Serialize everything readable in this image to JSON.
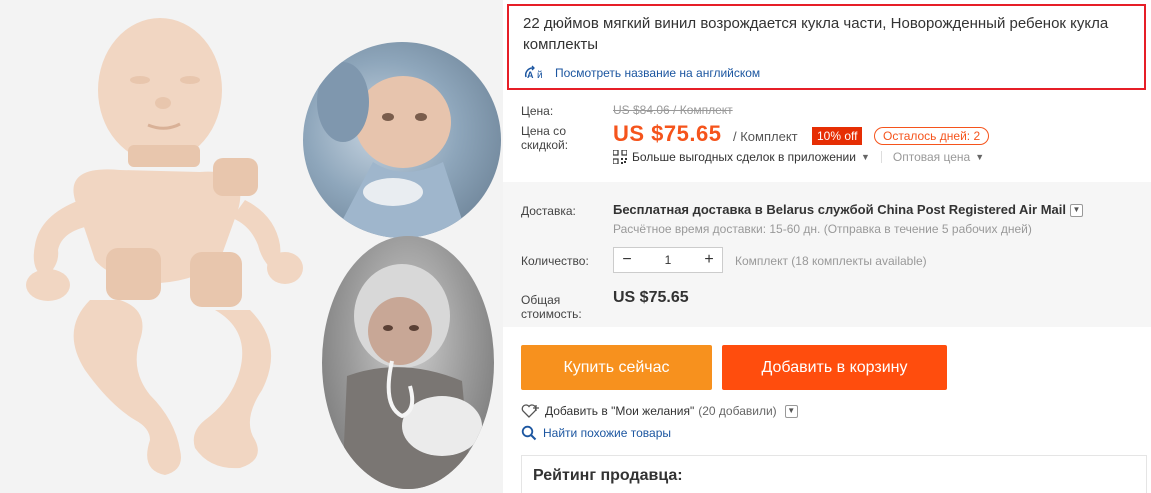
{
  "product": {
    "title": "22 дюймов мягкий винил возрождается кукла части, Новорожденный ребенок кукла комплекты",
    "translate_link": "Посмотреть название на английском",
    "translate_icon": "translate-icon"
  },
  "pricing": {
    "price_label": "Цена:",
    "old_price": "US $84.06 / Комплект",
    "discount_price_label": "Цена со скидкой:",
    "new_price": "US $75.65",
    "per_unit": "/ Комплект",
    "discount_badge": "10% off",
    "days_left": "Осталось дней: 2",
    "app_deals": "Больше выгодных сделок в приложении",
    "wholesale": "Оптовая цена",
    "accent_color": "#f5541c"
  },
  "shipping": {
    "label": "Доставка:",
    "main": "Бесплатная доставка в Belarus службой China Post Registered Air Mail",
    "estimate": "Расчётное время доставки: 15-60 дн. (Отправка в течение 5 рабочих дней)"
  },
  "quantity": {
    "label": "Количество:",
    "minus": "−",
    "value": "1",
    "plus": "+",
    "available": "Комплект (18 комплекты available)"
  },
  "total": {
    "label": "Общая стоимость:",
    "value": "US $75.65"
  },
  "actions": {
    "buy_now": "Купить сейчас",
    "add_to_cart": "Добавить в корзину",
    "buy_color": "#f7911e",
    "cart_color": "#ff4d0d"
  },
  "wishlist": {
    "label": "Добавить в \"Мои желания\"",
    "count": "(20 добавили)"
  },
  "similar": {
    "label": "Найти похожие товары"
  },
  "seller": {
    "title": "Рейтинг продавца:"
  }
}
